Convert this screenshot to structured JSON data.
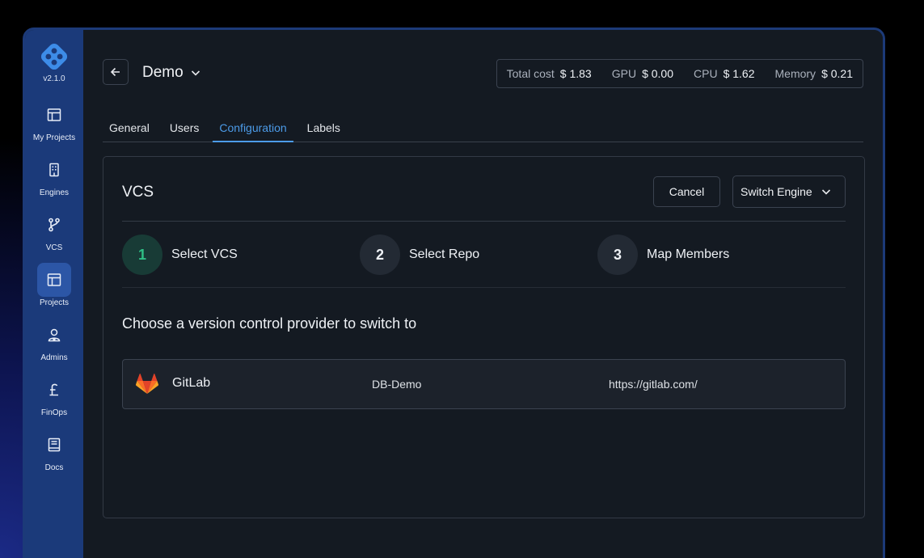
{
  "app": {
    "version": "v2.1.0"
  },
  "sidebar": {
    "items": [
      {
        "label": "My Projects",
        "icon": "layout-icon"
      },
      {
        "label": "Engines",
        "icon": "building-icon"
      },
      {
        "label": "VCS",
        "icon": "git-branch-icon"
      },
      {
        "label": "Projects",
        "icon": "layout-icon",
        "active": true
      },
      {
        "label": "Admins",
        "icon": "admin-user-icon"
      },
      {
        "label": "FinOps",
        "icon": "pound-icon"
      },
      {
        "label": "Docs",
        "icon": "book-icon"
      }
    ]
  },
  "header": {
    "project_name": "Demo",
    "costs": [
      {
        "label": "Total cost",
        "value": "$ 1.83"
      },
      {
        "label": "GPU",
        "value": "$ 0.00"
      },
      {
        "label": "CPU",
        "value": "$ 1.62"
      },
      {
        "label": "Memory",
        "value": "$ 0.21"
      }
    ]
  },
  "tabs": [
    {
      "label": "General"
    },
    {
      "label": "Users"
    },
    {
      "label": "Configuration",
      "active": true
    },
    {
      "label": "Labels"
    }
  ],
  "card": {
    "title": "VCS",
    "cancel_label": "Cancel",
    "switch_label": "Switch Engine",
    "steps": [
      {
        "number": "1",
        "label": "Select VCS",
        "active": true
      },
      {
        "number": "2",
        "label": "Select Repo"
      },
      {
        "number": "3",
        "label": "Map Members"
      }
    ],
    "prompt": "Choose a version control provider to switch to",
    "providers": [
      {
        "name": "GitLab",
        "repo": "DB-Demo",
        "url": "https://gitlab.com/",
        "icon": "gitlab-icon"
      }
    ]
  },
  "colors": {
    "sidebar": "#1b3a7a",
    "accent": "#4c9be8",
    "step_active": "#2fbf86",
    "background": "#141a22"
  }
}
